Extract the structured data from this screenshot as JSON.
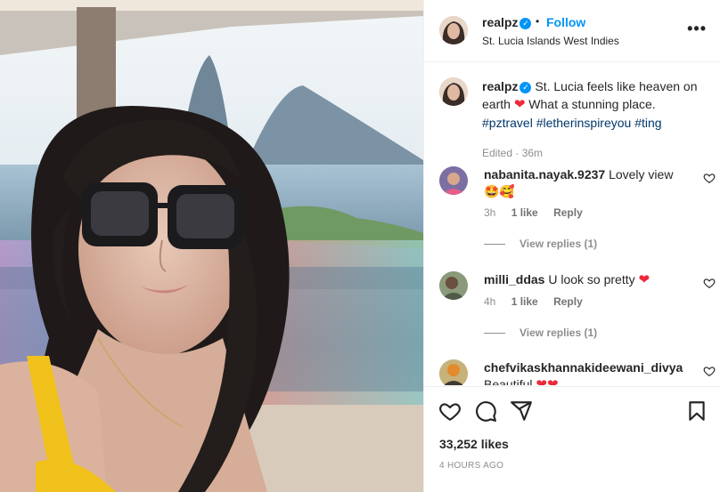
{
  "post": {
    "username": "realpz",
    "verified_mark": "✓",
    "separator": "•",
    "follow_label": "Follow",
    "location": "St. Lucia Islands West Indies",
    "more_icon": "•••"
  },
  "caption": {
    "username": "realpz",
    "text_before": "St. Lucia feels like heaven on earth",
    "heart": "❤",
    "text_after": "What a stunning place.",
    "hashtags": [
      "#pztravel",
      "#letherinspireyou",
      "#ting"
    ],
    "meta": "Edited · 36m"
  },
  "comments": [
    {
      "username": "nabanita.nayak.9237",
      "text": "Lovely view",
      "emoji": "🤩🥰",
      "time": "3h",
      "likes": "1 like",
      "reply_label": "Reply",
      "view_replies": "View replies (1)"
    },
    {
      "username": "milli_ddas",
      "text": "U look so pretty",
      "emoji": "❤",
      "time": "4h",
      "likes": "1 like",
      "reply_label": "Reply",
      "view_replies": "View replies (1)"
    },
    {
      "username": "chefvikaskhannakideewani_divya",
      "text": "Beautiful",
      "emoji": "❤❤"
    }
  ],
  "footer": {
    "likes": "33,252 likes",
    "timestamp": "4 HOURS AGO"
  },
  "icons": {
    "like": "heart-outline-icon",
    "comment": "comment-bubble-icon",
    "share": "paper-plane-icon",
    "save": "bookmark-icon"
  },
  "colors": {
    "link_blue": "#0095f6",
    "hashtag": "#00376b",
    "heart_red": "#ed2939",
    "muted_text": "#8e8e8e"
  }
}
